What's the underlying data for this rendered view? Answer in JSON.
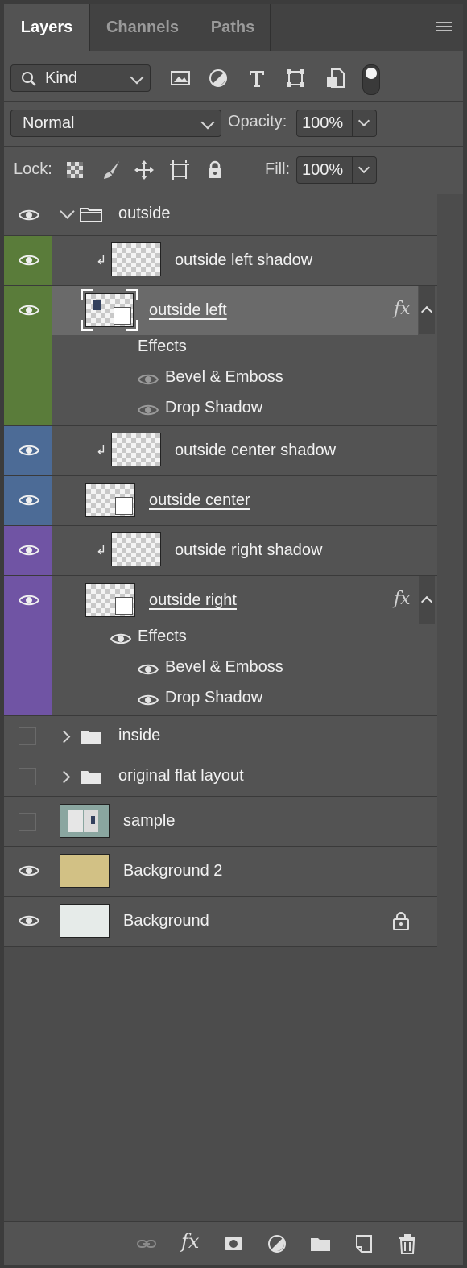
{
  "tabs": [
    {
      "label": "Layers",
      "active": true
    },
    {
      "label": "Channels",
      "active": false
    },
    {
      "label": "Paths",
      "active": false
    }
  ],
  "filter": {
    "kind_label": "Kind"
  },
  "blend": {
    "mode": "Normal",
    "opacity_label": "Opacity:",
    "opacity_value": "100%"
  },
  "lock": {
    "label": "Lock:",
    "fill_label": "Fill:",
    "fill_value": "100%"
  },
  "colors": {
    "green": "#5a7c3a",
    "blue": "#4c6b96",
    "violet": "#7054a4",
    "selected": "#6a6a6a",
    "panel": "#535353"
  },
  "layers": [
    {
      "name": "outside",
      "type": "group",
      "visible": true
    },
    {
      "name": "outside left shadow",
      "type": "clipped",
      "visible": true,
      "color_tag": "green"
    },
    {
      "name": "outside left",
      "type": "smart-object",
      "visible": true,
      "color_tag": "green",
      "selected": true,
      "fx": "fx",
      "effects_label": "Effects",
      "effects": [
        "Bevel & Emboss",
        "Drop Shadow"
      ]
    },
    {
      "name": "outside center shadow",
      "type": "clipped",
      "visible": true,
      "color_tag": "blue"
    },
    {
      "name": "outside center",
      "type": "smart-object",
      "visible": true,
      "color_tag": "blue"
    },
    {
      "name": "outside right shadow",
      "type": "clipped",
      "visible": true,
      "color_tag": "violet"
    },
    {
      "name": "outside right",
      "type": "smart-object",
      "visible": true,
      "color_tag": "violet",
      "fx": "fx",
      "effects_label": "Effects",
      "effects": [
        "Bevel & Emboss",
        "Drop Shadow"
      ]
    },
    {
      "name": "inside",
      "type": "group",
      "visible": false
    },
    {
      "name": "original flat layout",
      "type": "group",
      "visible": false
    },
    {
      "name": "sample",
      "type": "image",
      "visible": false
    },
    {
      "name": "Background 2",
      "type": "fill",
      "visible": true
    },
    {
      "name": "Background",
      "type": "fill",
      "visible": true,
      "locked": true
    }
  ],
  "footer": {
    "fx_label": "fx"
  }
}
